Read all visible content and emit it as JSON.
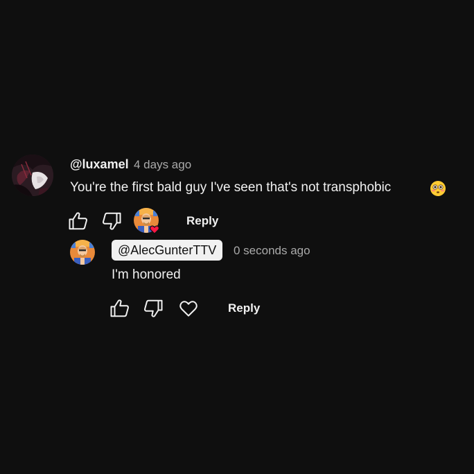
{
  "comment": {
    "username": "@luxamel",
    "timestamp": "4 days ago",
    "text": "You're the first bald guy I've seen that's not transphobic",
    "emoji": "flushed-face-emoji",
    "actions": {
      "like_icon": "thumb-up-icon",
      "dislike_icon": "thumb-down-icon",
      "creator_heart": "creator-heart-avatar",
      "reply_label": "Reply"
    }
  },
  "reply": {
    "username": "@AlecGunterTTV",
    "timestamp": "0 seconds ago",
    "text": "I'm honored",
    "actions": {
      "like_icon": "thumb-up-icon",
      "dislike_icon": "thumb-down-icon",
      "heart_icon": "heart-outline-icon",
      "reply_label": "Reply"
    }
  },
  "colors": {
    "background": "#0f0f0f",
    "text": "#f1f1f1",
    "secondary_text": "#aaaaaa",
    "heart": "#ff1744"
  }
}
